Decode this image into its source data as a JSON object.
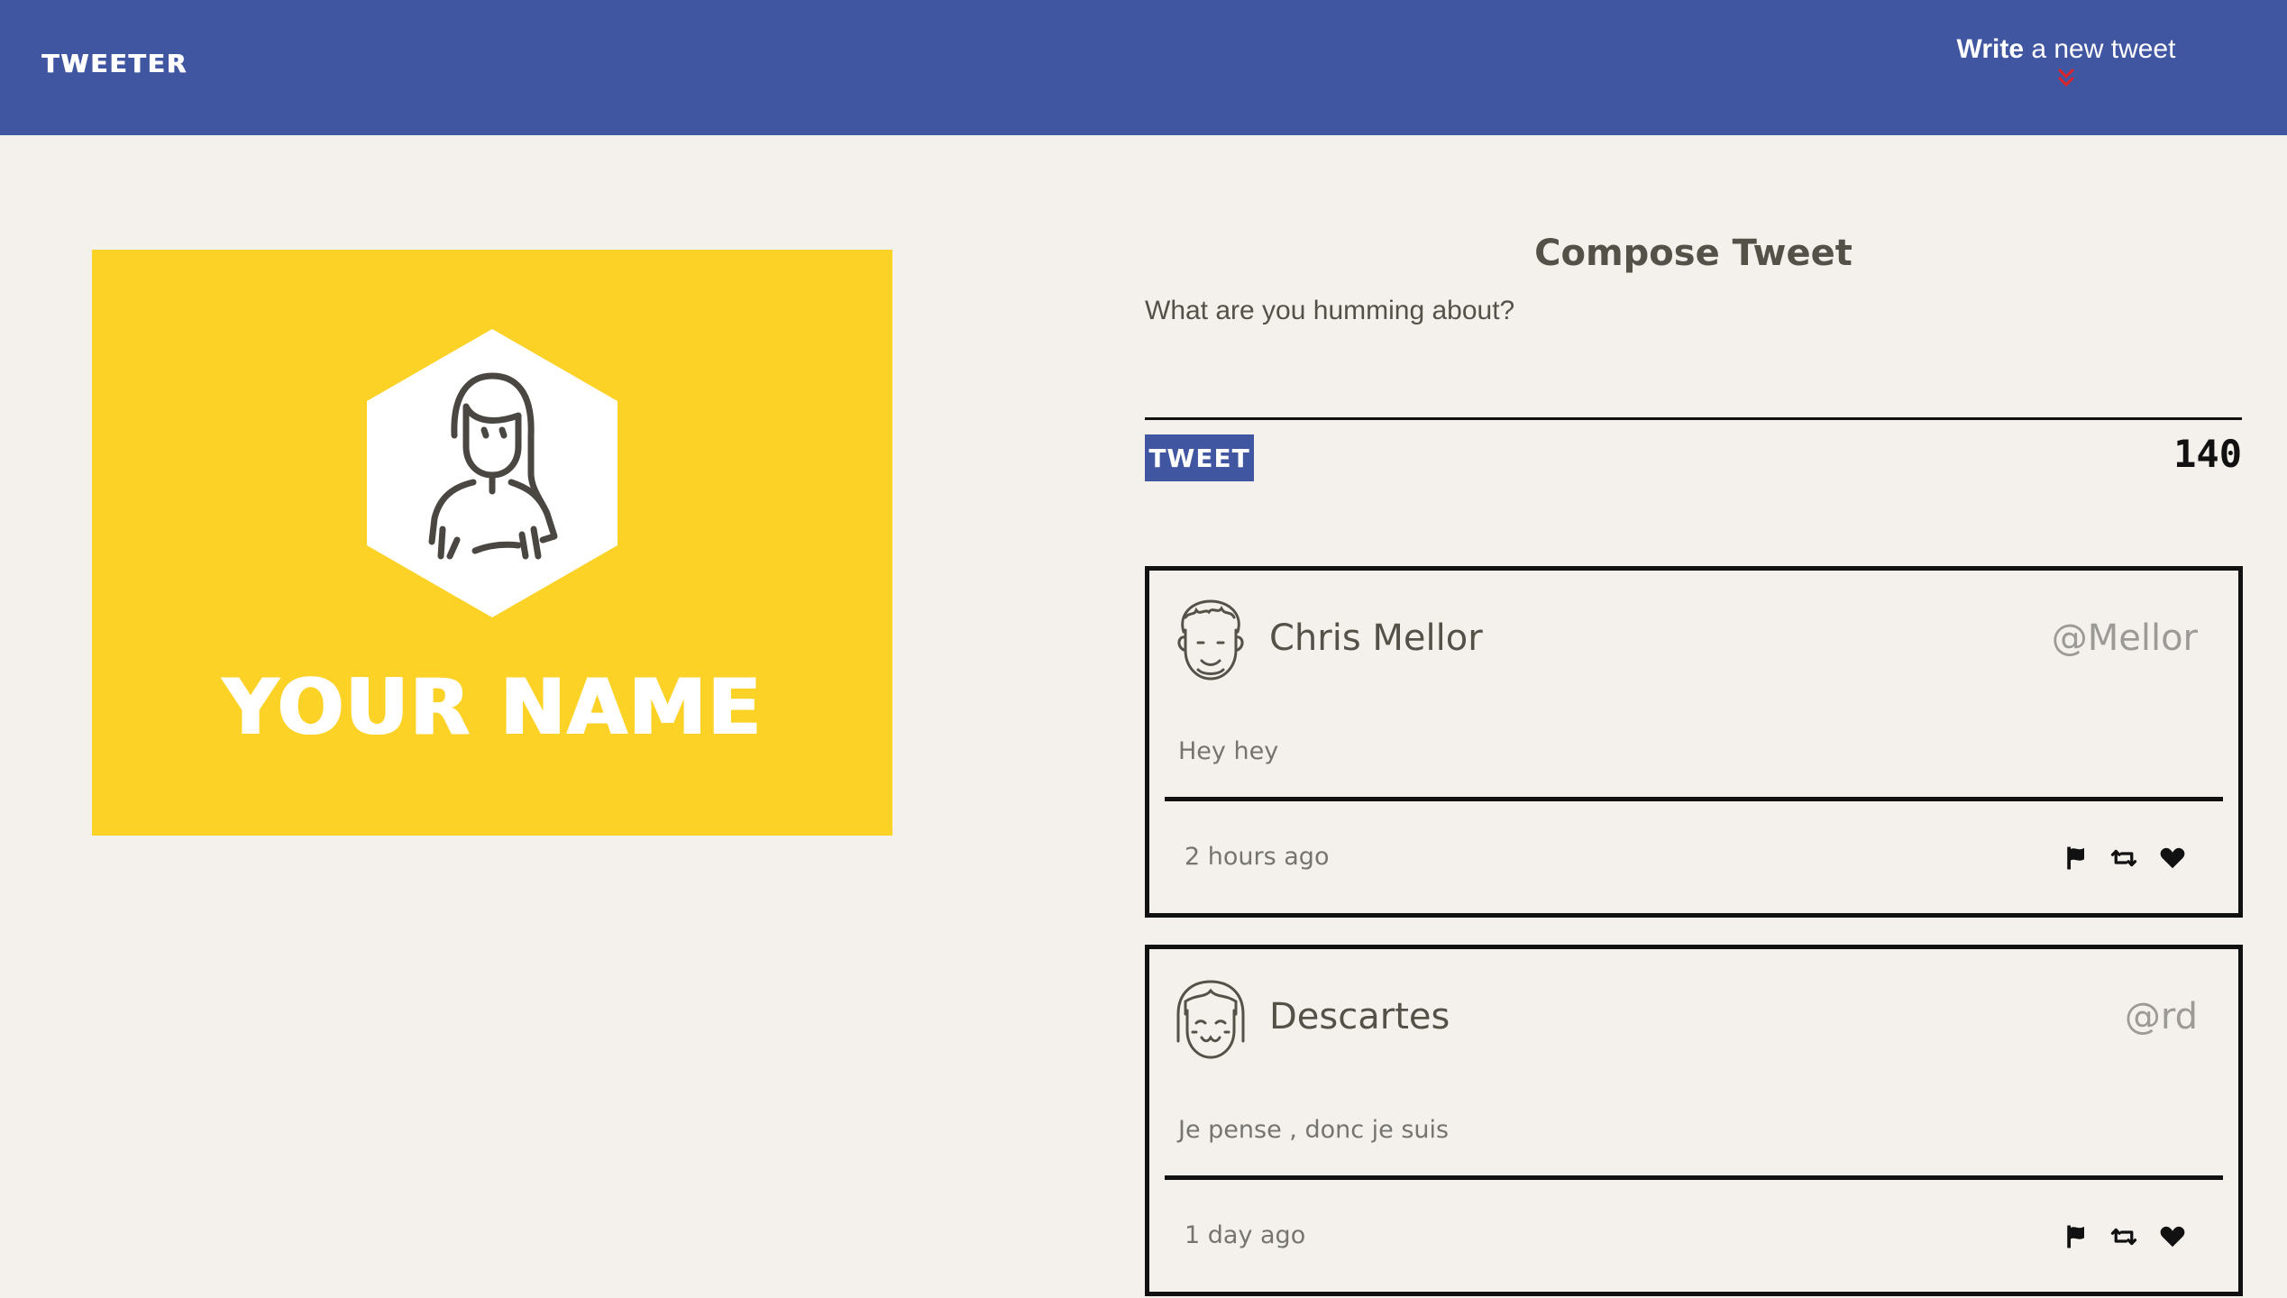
{
  "nav": {
    "brand": "Tweeter",
    "compose_toggle": {
      "bold": "Write",
      "rest": " a new tweet",
      "icon": "double-chevron-down-icon"
    }
  },
  "colors": {
    "nav_bg": "#4056a1",
    "page_bg": "#f4f1ec",
    "profile_bg": "#fdd227",
    "chevron": "#d9252b",
    "text": "#545149",
    "handle": "#9b9a96"
  },
  "profile": {
    "name": "YOUR NAME",
    "avatar_icon": "woman-avatar-hexagon-icon"
  },
  "compose": {
    "title": "Compose Tweet",
    "placeholder": "What are you humming about?",
    "button_label": "Tweet",
    "counter": "140"
  },
  "tweets": [
    {
      "name": "Chris Mellor",
      "handle": "@Mellor",
      "avatar_icon": "curly-hair-avatar-icon",
      "body": "Hey hey",
      "time": "2 hours ago",
      "actions": [
        "flag-icon",
        "retweet-icon",
        "heart-icon"
      ]
    },
    {
      "name": "Descartes",
      "handle": "@rd",
      "avatar_icon": "bob-hair-avatar-icon",
      "body": "Je pense , donc je suis",
      "time": "1 day ago",
      "actions": [
        "flag-icon",
        "retweet-icon",
        "heart-icon"
      ]
    }
  ]
}
